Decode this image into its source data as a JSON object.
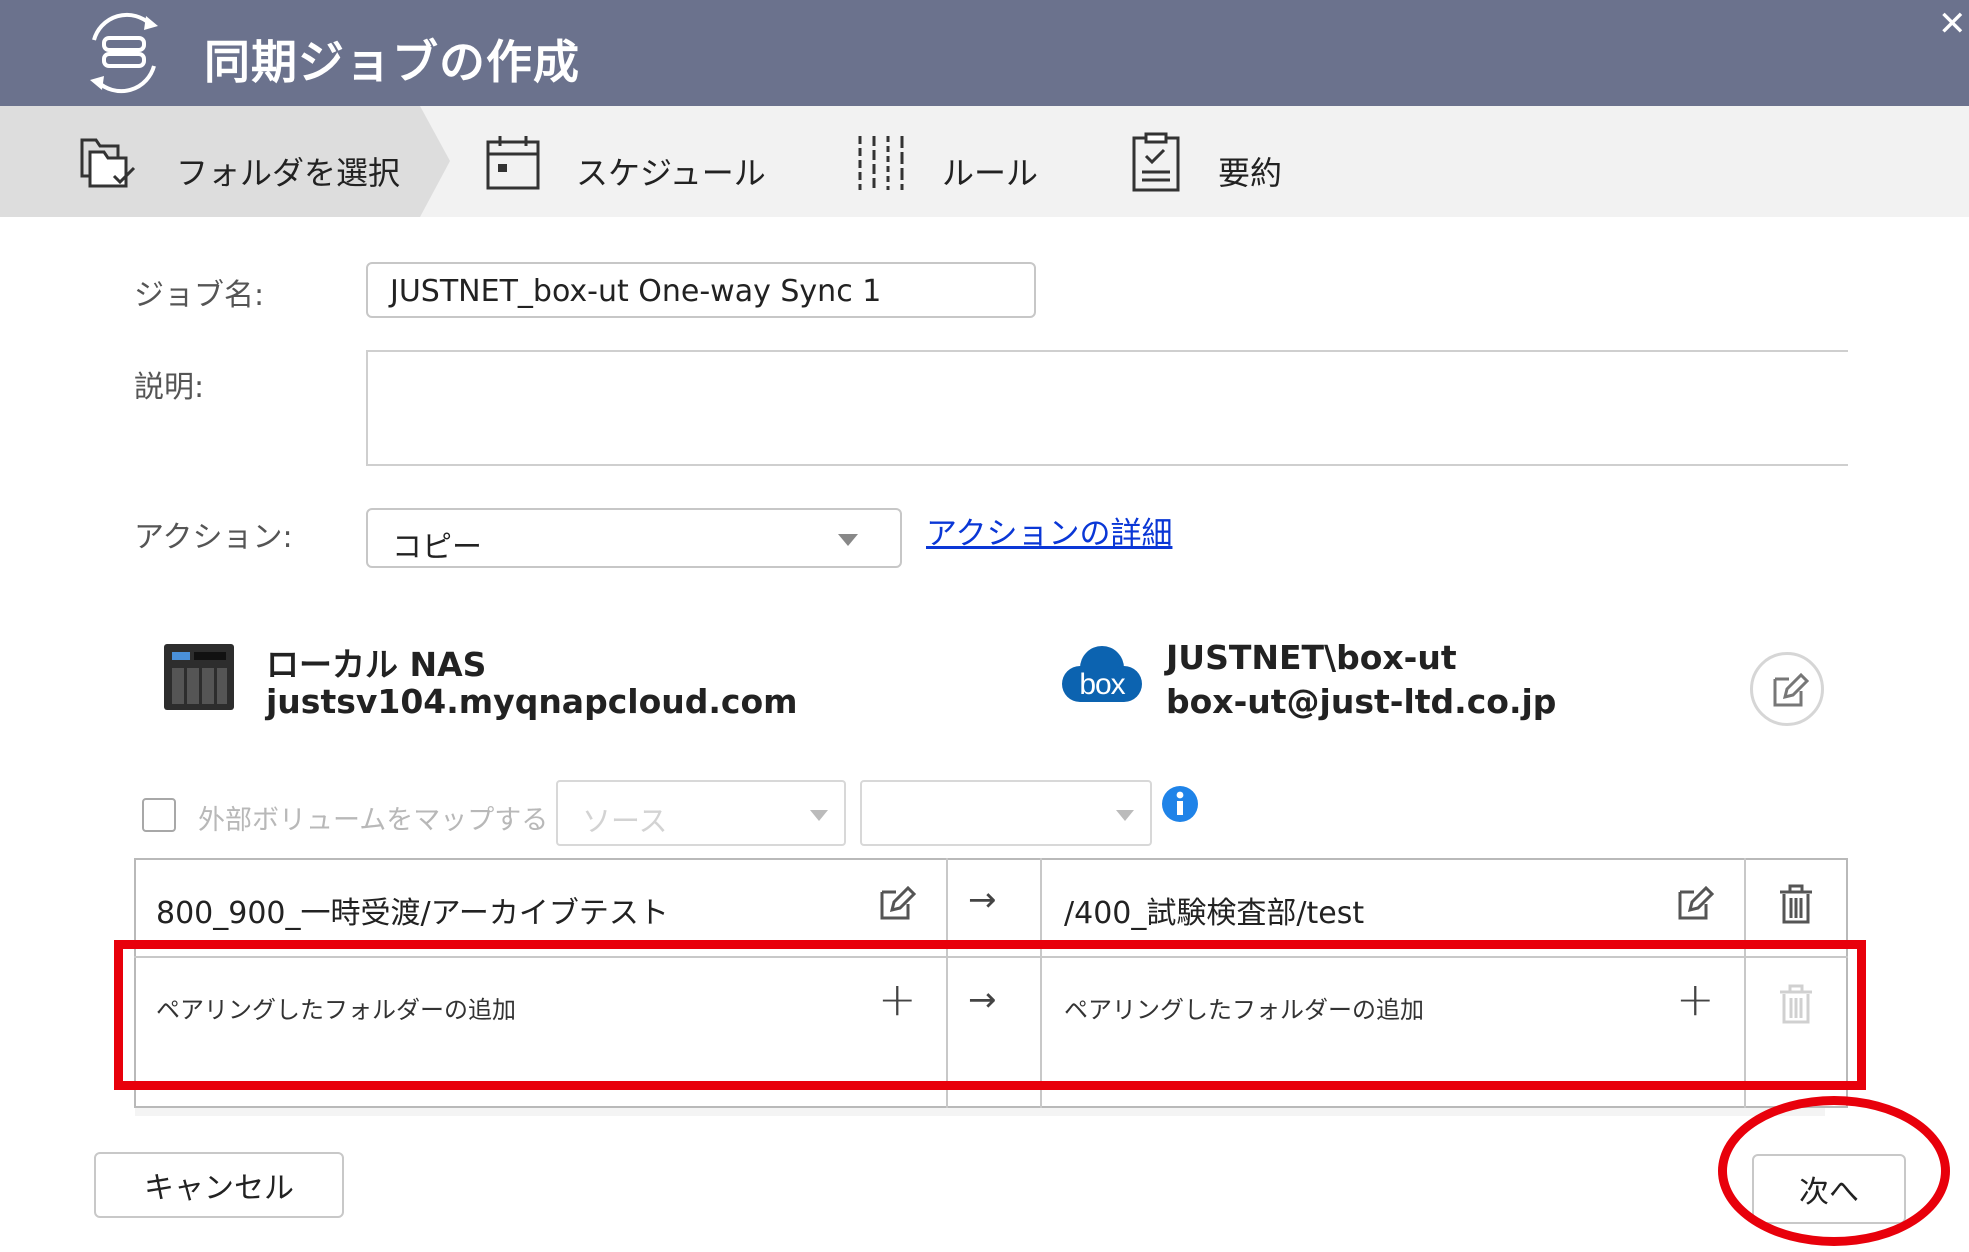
{
  "window": {
    "title": "同期ジョブの作成",
    "close_glyph": "✕",
    "icon": "sync-storage-icon",
    "title_bg": "#6b728d"
  },
  "steps": [
    {
      "label": "フォルダを選択",
      "icon": "folder-select-icon",
      "active": true
    },
    {
      "label": "スケジュール",
      "icon": "calendar-icon",
      "active": false
    },
    {
      "label": "ルール",
      "icon": "sliders-icon",
      "active": false
    },
    {
      "label": "要約",
      "icon": "clipboard-icon",
      "active": false
    }
  ],
  "form": {
    "job_name_label": "ジョブ名:",
    "job_name_value": "JUSTNET_box-ut One-way Sync 1",
    "description_label": "説明:",
    "description_value": "",
    "action_label": "アクション:",
    "action_value": "コピー",
    "action_details_link": "アクションの詳細"
  },
  "source": {
    "name": "ローカル NAS",
    "host": "justsv104.myqnapcloud.com",
    "icon": "nas-device-icon"
  },
  "destination": {
    "name": "JUSTNET\\box-ut",
    "account": "box-ut@just-ltd.co.jp",
    "logo_text": "box",
    "icon": "box-cloud-icon",
    "brand_color": "#0c63b0"
  },
  "map_volume": {
    "label": "外部ボリュームをマップする",
    "checked": false,
    "source_placeholder": "ソース",
    "dest_placeholder": ""
  },
  "pairs": [
    {
      "source": "800_900_一時受渡/アーカイブテスト",
      "arrow": "→",
      "dest": "/400_試験検査部/test"
    }
  ],
  "add_pair": {
    "source_placeholder": "ペアリングしたフォルダーの追加",
    "arrow": "→",
    "dest_placeholder": "ペアリングしたフォルダーの追加",
    "plus": "+"
  },
  "buttons": {
    "cancel": "キャンセル",
    "next": "次へ"
  },
  "annotations": {
    "highlight_color": "#e8000b"
  }
}
